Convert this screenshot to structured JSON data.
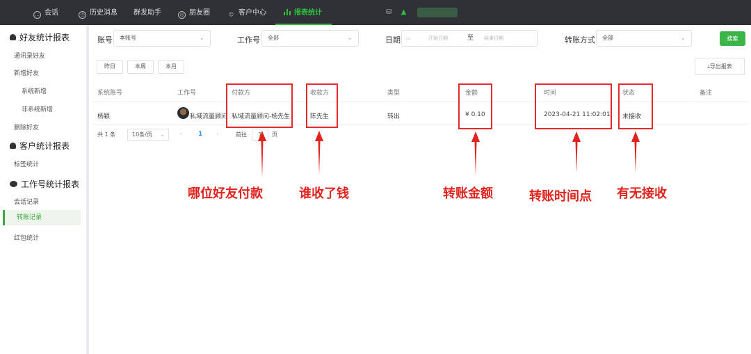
{
  "topbar": {
    "tabs": [
      {
        "label": "会话",
        "icon": "chat-icon"
      },
      {
        "label": "历史消息",
        "icon": "history-icon"
      },
      {
        "label": "群发助手",
        "icon": "broadcast-icon"
      },
      {
        "label": "朋友圈",
        "icon": "moments-icon"
      },
      {
        "label": "客户中心",
        "icon": "customer-icon"
      },
      {
        "label": "报表统计",
        "icon": "chart-icon",
        "active": true
      }
    ],
    "accent": "#2fbd3f"
  },
  "sidebar": {
    "groups": [
      {
        "label": "好友统计报表",
        "items": [
          "通讯录好友",
          "新增好友",
          "系统新增",
          "非系统新增",
          "删除好友"
        ]
      },
      {
        "label": "客户统计报表",
        "items": [
          "标签统计"
        ]
      },
      {
        "label": "工作号统计报表",
        "items": [
          "会话记录",
          "转账记录",
          "红包统计"
        ]
      }
    ],
    "active_item": "转账记录"
  },
  "filters": {
    "account_label": "账号",
    "account_value": "本账号",
    "worker_label": "工作号",
    "worker_value": "全部",
    "date_label": "日期",
    "date_start_placeholder": "开始日期",
    "date_sep": "至",
    "date_end_placeholder": "结束日期",
    "transfer_label": "转账方式",
    "transfer_value": "全部",
    "search_label": "搜索"
  },
  "quick": {
    "yesterday": "昨日",
    "this_week": "本周",
    "this_month": "本月",
    "export": "导出报表"
  },
  "table": {
    "headers": [
      "系统账号",
      "工作号",
      "付款方",
      "收款方",
      "类型",
      "金额",
      "时间",
      "状态",
      "备注"
    ],
    "rows": [
      {
        "system_account": "杨颖",
        "worker": "私域流量顾问",
        "payer": "私域流量顾问-杨先生",
        "payee": "陈先生",
        "type": "转出",
        "amount": "¥ 0.10",
        "time": "2023-04-21 11:02:01",
        "status": "未接收",
        "remark": ""
      }
    ]
  },
  "pagination": {
    "total": "共 1 条",
    "page_size": "10条/页",
    "prev": "‹",
    "current": "1",
    "next": "›",
    "goto": "前往",
    "goto_value": "1",
    "page_unit": "页"
  },
  "annotations": {
    "payer": "哪位好友付款",
    "payee": "谁收了钱",
    "amount": "转账金额",
    "time": "转账时间点",
    "status": "有无接收"
  },
  "annotation_color": "#e1231e"
}
